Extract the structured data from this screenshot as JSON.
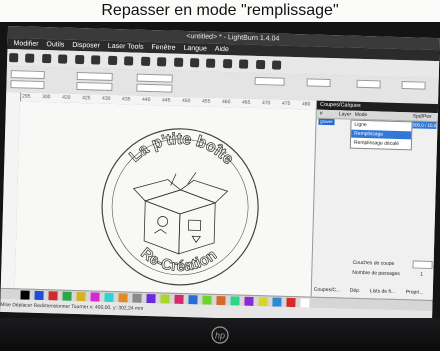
{
  "caption": "Repasser en mode \"remplissage\"",
  "window_title": "<untitled> * - LightBurn 1.4.04",
  "menu": [
    "Modifier",
    "Outils",
    "Disposer",
    "Laser Tools",
    "Fenêtre",
    "Langue",
    "Aide"
  ],
  "panel": {
    "title": "Coupes/Calques",
    "columns": [
      "#",
      "Layer",
      "Mode",
      "Spd/Pwr"
    ],
    "layer_label": "graver",
    "layer_speed": "500,0 / 10,0",
    "mode_options": [
      "Ligne",
      "Remplissage",
      "Remplissage décalé"
    ],
    "highlighted_option": "Remplissage",
    "cut_count_label": "Couches de coupe",
    "pass_count_label": "Nombre de passages",
    "pass_count_value": "1",
    "tabs": [
      "Coupes/C...",
      "Dép.",
      "Lists de fi...",
      "Propri..."
    ]
  },
  "ruler_ticks_h": [
    "295",
    "300",
    "420",
    "425",
    "430",
    "435",
    "440",
    "445",
    "450",
    "455",
    "460",
    "465",
    "470",
    "475",
    "480"
  ],
  "logo_text": {
    "top": "La p'tite boîte",
    "bottom": "Re-Création"
  },
  "status": "Mise  Déplacer  Redimensionner  Tourner  x: 400,00, y: 302,24 mm",
  "colors": {
    "accent": "#3478d6",
    "layer": "#2266cc",
    "palette": [
      "#000000",
      "#1f4fd6",
      "#d12a2a",
      "#2aa848",
      "#d6b21f",
      "#d62ad1",
      "#2ad6d1",
      "#e08a2a",
      "#8a8a8a",
      "#6a2ad6",
      "#a8d62a",
      "#d62a6a",
      "#2a6ad6",
      "#6ad62a",
      "#d66a2a",
      "#2ad68a",
      "#8a2ad6",
      "#d6d62a",
      "#2a8ad6",
      "#d62a2a",
      "#ffffff"
    ]
  },
  "icons": [
    "new-file-icon",
    "open-icon",
    "save-icon",
    "scan-icon",
    "undo-icon",
    "copy-icon",
    "paste-icon",
    "delete-icon",
    "move-icon",
    "zoom-in-icon",
    "zoom-out-icon",
    "zoom-fit-icon",
    "frame-icon",
    "camera-icon",
    "settings-icon",
    "laser-icon",
    "tools-icon"
  ],
  "brand": "hp"
}
